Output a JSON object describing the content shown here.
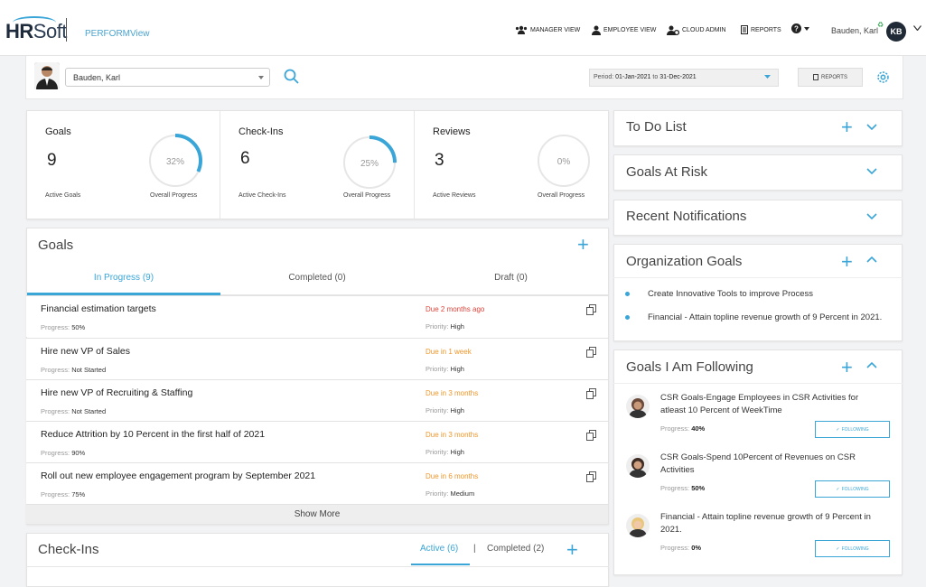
{
  "header": {
    "logo_text_a": "HR",
    "logo_text_b": "Soft",
    "product": "PERFORMView",
    "nav": [
      "MANAGER VIEW",
      "EMPLOYEE VIEW",
      "CLOUD ADMIN",
      "REPORTS"
    ],
    "user_name": "Bauden, Karl",
    "user_initials": "KB"
  },
  "selector": {
    "employee": "Bauden, Karl",
    "period_prefix": "Period:",
    "period_from": "01-Jan-2021",
    "period_to_word": "to",
    "period_to": "31-Dec-2021",
    "reports_label": "REPORTS"
  },
  "stats": [
    {
      "title": "Goals",
      "count": "9",
      "count_label": "Active Goals",
      "percent": "32%",
      "progress": 0.32,
      "progress_label": "Overall Progress"
    },
    {
      "title": "Check-Ins",
      "count": "6",
      "count_label": "Active Check-Ins",
      "percent": "25%",
      "progress": 0.25,
      "progress_label": "Overall Progress"
    },
    {
      "title": "Reviews",
      "count": "3",
      "count_label": "Active Reviews",
      "percent": "0%",
      "progress": 0.0,
      "progress_label": "Overall Progress"
    }
  ],
  "goals": {
    "title": "Goals",
    "tabs": [
      "In Progress (9)",
      "Completed (0)",
      "Draft (0)"
    ],
    "progress_label": "Progress:",
    "priority_label": "Priority:",
    "rows": [
      {
        "title": "Financial estimation targets",
        "progress": "50%",
        "due": "Due 2 months ago",
        "priority": "High"
      },
      {
        "title": "Hire new VP of Sales",
        "progress": "Not Started",
        "due": "Due in 1 week",
        "priority": "High"
      },
      {
        "title": "Hire new VP of Recruiting & Staffing",
        "progress": "Not Started",
        "due": "Due in 3 months",
        "priority": "High"
      },
      {
        "title": "Reduce Attrition by 10 Percent in the first half of 2021",
        "progress": "90%",
        "due": "Due in 3 months",
        "priority": "High"
      },
      {
        "title": "Roll out new employee engagement program by September 2021",
        "progress": "75%",
        "due": "Due in 6 months",
        "priority": "Medium"
      }
    ],
    "show_more": "Show More"
  },
  "checkins": {
    "title": "Check-Ins",
    "tab_active": "Active (6)",
    "separator": "|",
    "tab_completed": "Completed (2)"
  },
  "right": {
    "todo": "To Do List",
    "at_risk": "Goals At Risk",
    "notifications": "Recent Notifications",
    "org_goals": {
      "title": "Organization Goals",
      "items": [
        "Create Innovative Tools to improve Process",
        "Financial - Attain topline revenue growth of 9 Percent in 2021."
      ]
    },
    "following": {
      "title": "Goals I Am Following",
      "progress_label": "Progress:",
      "button": "FOLLOWING",
      "items": [
        {
          "title": "CSR Goals-Engage Employees in CSR Activities for atleast 10 Percent of WeekTime",
          "progress": "40%"
        },
        {
          "title": "CSR Goals-Spend 10Percent of Revenues on CSR Activities",
          "progress": "50%"
        },
        {
          "title": "Financial - Attain topline revenue growth of 9 Percent in 2021.",
          "progress": "0%"
        }
      ]
    }
  },
  "colors": {
    "accent": "#3aa6d8",
    "overdue": "#e0443a",
    "due_soon": "#f0962a"
  }
}
